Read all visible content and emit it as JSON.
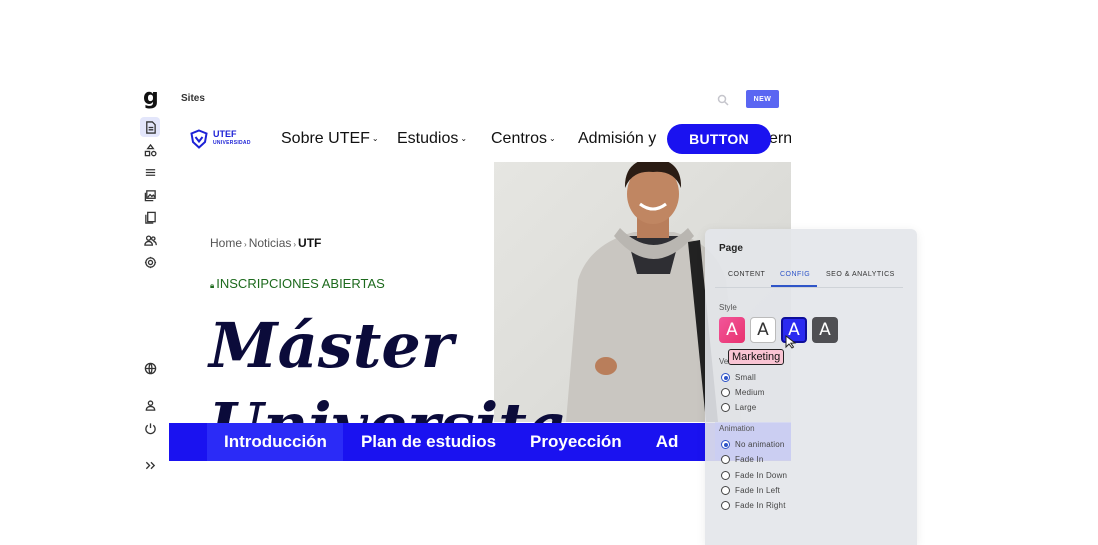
{
  "rail": {
    "logo": "g",
    "items": [
      "document-icon",
      "shapes-icon",
      "menu-icon",
      "media-icon",
      "pages-icon",
      "users-icon",
      "settings-icon"
    ],
    "bottom_items": [
      "globe-icon",
      "user-icon",
      "power-icon",
      "expand-icon"
    ]
  },
  "header": {
    "title": "Sites",
    "new_label": "NEW"
  },
  "site": {
    "brand_name": "UTEF",
    "brand_sub": "UNIVERSIDAD",
    "nav": [
      "Sobre UTEF",
      "Estudios",
      "Centros",
      "Admisión y",
      "erna"
    ],
    "button_label": "BUTTON",
    "breadcrumb": [
      "Home",
      "Noticias",
      "UTF"
    ],
    "eyebrow": "INSCRIPCIONES ABIERTAS",
    "hero_line1": "Máster",
    "hero_line2": "Universita",
    "tabs": [
      "Introducción",
      "Plan de estudios",
      "Proyección",
      "Ad"
    ],
    "accent": "#1a12f0"
  },
  "panel": {
    "title": "Page",
    "tabs": [
      "CONTENT",
      "CONFIG",
      "SEO & ANALYTICS"
    ],
    "active_tab": "CONFIG",
    "style_label": "Style",
    "style_options": [
      "A",
      "A",
      "A",
      "A"
    ],
    "tooltip": "Marketing",
    "size_label": "Ve",
    "sizes": [
      "Small",
      "Medium",
      "Large"
    ],
    "size_selected": "Small",
    "animation_label": "Animation",
    "animations": [
      "No animation",
      "Fade In",
      "Fade In Down",
      "Fade In Left",
      "Fade In Right"
    ],
    "animation_selected": "No animation"
  }
}
